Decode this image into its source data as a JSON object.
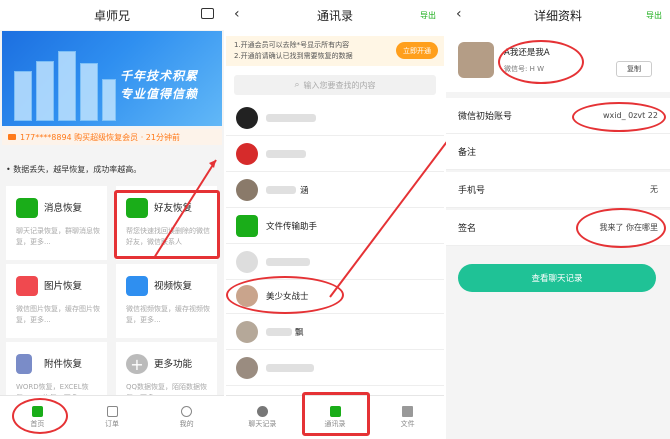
{
  "panel1": {
    "title": "卓师兄",
    "banner": {
      "line1": "千年技术积累",
      "line2": "专业值得信赖"
    },
    "notice": "177****8894 购买超级恢复会员 · 21分钟前",
    "section_title": "• 数据丢失，越早恢复，成功率越高。",
    "cards": [
      {
        "name": "消息恢复",
        "desc": "聊天记录恢复，群聊消息恢复，更多..."
      },
      {
        "name": "好友恢复",
        "desc": "帮您快速找回误删除的微信好友，微信联系人"
      },
      {
        "name": "图片恢复",
        "desc": "微信图片恢复，缓存图片恢复，更多..."
      },
      {
        "name": "视频恢复",
        "desc": "微信视频恢复，缓存视频恢复，更多..."
      },
      {
        "name": "附件恢复",
        "desc": "WORD恢复，EXCEL恢复，PPT恢复，更多..."
      },
      {
        "name": "更多功能",
        "desc": "QQ数据恢复，陌陌数据恢复，更多..."
      }
    ],
    "tabs": [
      {
        "label": "首页"
      },
      {
        "label": "订单"
      },
      {
        "label": "我的"
      }
    ]
  },
  "panel2": {
    "title": "通讯录",
    "export": "导出",
    "vip_line1": "1.开通会员可以去除*号显示所有内容",
    "vip_line2": "2.开通前请确认已找到需要恢复的数据",
    "vip_button": "立即开通",
    "search_placeholder": "输入您要查找的内容",
    "contacts": [
      {
        "name": ""
      },
      {
        "name": ""
      },
      {
        "name": "涵"
      },
      {
        "name": "文件传输助手"
      },
      {
        "name": ""
      },
      {
        "name": ""
      },
      {
        "name": "美少女战士"
      },
      {
        "name": "飘"
      },
      {
        "name": ""
      }
    ],
    "tabs": [
      {
        "label": "聊天记录"
      },
      {
        "label": "通讯录"
      },
      {
        "label": "文件"
      }
    ]
  },
  "panel3": {
    "title": "详细资料",
    "export": "导出",
    "nickname": "A我还是我A",
    "wechat_id": "微信号: H      W",
    "copy": "复制",
    "rows": [
      {
        "label": "微信初始账号",
        "value": "wxid_      0zvt      22"
      },
      {
        "label": "备注",
        "value": ""
      },
      {
        "label": "手机号",
        "value": "无"
      },
      {
        "label": "签名",
        "value": "我来了 你在哪里"
      }
    ],
    "view_chat": "查看聊天记录"
  },
  "colors": {
    "accent_green": "#1aad19",
    "annotation_red": "#e53235",
    "button_teal": "#1fc296",
    "banner_blue": "#2f8ff0"
  }
}
